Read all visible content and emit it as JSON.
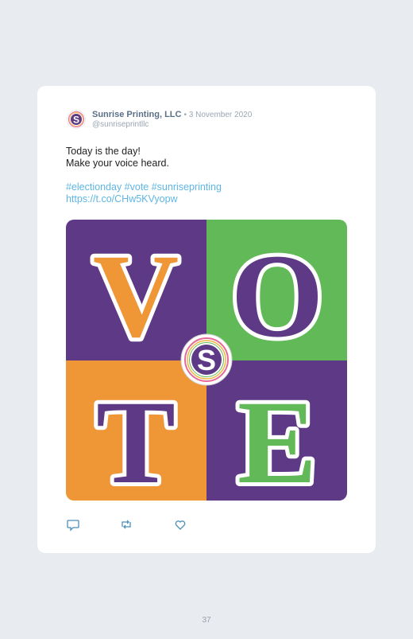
{
  "tweet": {
    "author_name": "Sunrise Printing, LLC",
    "date": "• 3 November 2020",
    "handle": "@sunriseprintllc",
    "text_lines": [
      "Today is the day!",
      "Make your voice heard."
    ],
    "hashtags": "#electionday #vote #sunriseprinting",
    "link": "https://t.co/CHw5KVyopw",
    "image": {
      "letters": [
        "V",
        "O",
        "T",
        "E"
      ],
      "logo_letter": "S",
      "colors": {
        "purple": "#5e3a86",
        "green": "#62b957",
        "orange": "#ef9736"
      }
    },
    "actions": {
      "reply_icon": "reply-icon",
      "retweet_icon": "retweet-icon",
      "like_icon": "heart-icon"
    }
  },
  "page_number": "37"
}
